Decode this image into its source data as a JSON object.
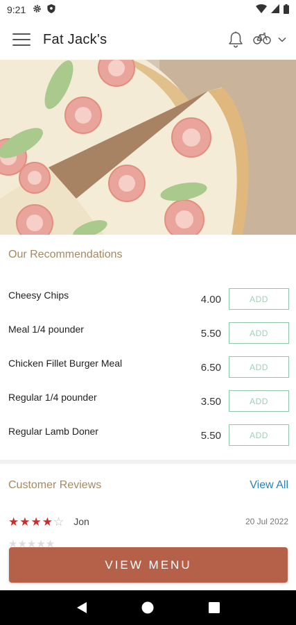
{
  "status_bar": {
    "time": "9:21",
    "left_icons": [
      "gear-icon",
      "shield-icon"
    ],
    "right_icons": [
      "wifi-icon",
      "signal-icon",
      "battery-icon"
    ]
  },
  "app_bar": {
    "title": "Fat Jack's",
    "icons": [
      "hamburger-menu-icon",
      "bell-icon",
      "bicycle-icon",
      "chevron-down-icon"
    ]
  },
  "hero": {
    "image": "pizza-photo"
  },
  "recommendations": {
    "title": "Our Recommendations",
    "items": [
      {
        "name": "Cheesy Chips",
        "price": "4.00",
        "button": "ADD"
      },
      {
        "name": "Meal 1/4 pounder",
        "price": "5.50",
        "button": "ADD"
      },
      {
        "name": "Chicken Fillet Burger Meal",
        "price": "6.50",
        "button": "ADD"
      },
      {
        "name": "Regular 1/4 pounder",
        "price": "3.50",
        "button": "ADD"
      },
      {
        "name": "Regular Lamb Doner",
        "price": "5.50",
        "button": "ADD"
      }
    ]
  },
  "reviews": {
    "title": "Customer Reviews",
    "view_all": "View All",
    "items": [
      {
        "rating": 4,
        "max_rating": 5,
        "reviewer": "Jon",
        "date": "20 Jul 2022"
      }
    ]
  },
  "view_menu_button": "VIEW MENU",
  "nav_bar": {
    "icons": [
      "back-icon",
      "home-icon",
      "recents-icon"
    ]
  },
  "colors": {
    "accent_gold": "#a48a61",
    "add_green": "#8fc7a9",
    "view_all_blue": "#2a82b8",
    "view_menu_brown": "#b5614a",
    "star_red": "#d12a2a"
  }
}
